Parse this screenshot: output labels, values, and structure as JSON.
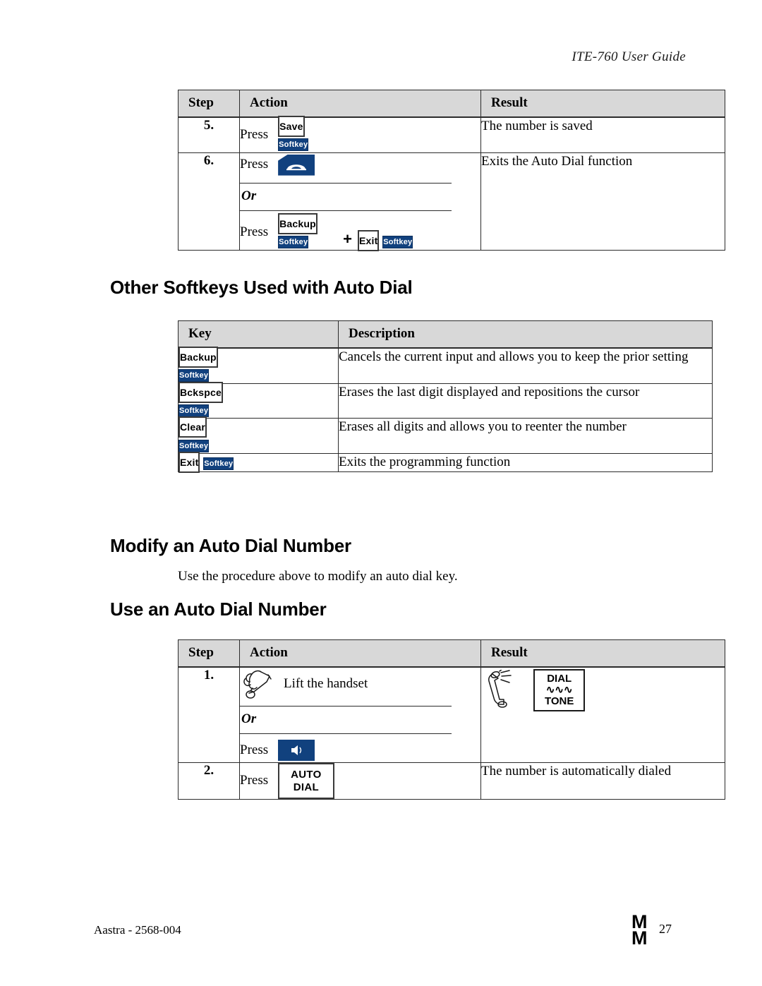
{
  "header": {
    "running_head": "ITE-760 User Guide"
  },
  "table_autodial_steps": {
    "columns": [
      "Step",
      "Action",
      "Result"
    ],
    "rows": [
      {
        "step": "5.",
        "press_label": "Press",
        "key": {
          "type": "softkey",
          "cap": "Save",
          "tag": "Softkey"
        },
        "result": "The number is saved"
      },
      {
        "step": "6.",
        "press_label": "Press",
        "key": {
          "type": "phone-key",
          "icon": "handset-icon"
        },
        "or_label": "Or",
        "press_label_2": "Press",
        "key_pair": {
          "first": {
            "cap": "Backup",
            "tag": "Softkey"
          },
          "operator": "+",
          "second": {
            "cap": "Exit",
            "tag": "Softkey"
          }
        },
        "result": "Exits the Auto Dial function"
      }
    ]
  },
  "heading_other_softkeys": "Other Softkeys Used with Auto Dial",
  "table_other_softkeys": {
    "columns": [
      "Key",
      "Description"
    ],
    "rows": [
      {
        "key_cap": "Backup",
        "key_tag": "Softkey",
        "description": "Cancels the current input and allows you to keep the prior setting"
      },
      {
        "key_cap": "Bckspce",
        "key_tag": "Softkey",
        "description": "Erases the last digit displayed and repositions the cursor"
      },
      {
        "key_cap": "Clear",
        "key_tag": "Softkey",
        "description": "Erases all digits and allows you to reenter the number"
      },
      {
        "key_cap": "Exit",
        "key_tag": "Softkey",
        "description": "Exits the programming function"
      }
    ]
  },
  "heading_modify": "Modify an Auto Dial Number",
  "paragraph_modify": "Use the procedure above to modify an auto dial key.",
  "heading_use": "Use an Auto Dial Number",
  "table_use_autodial": {
    "columns": [
      "Step",
      "Action",
      "Result"
    ],
    "rows": [
      {
        "step": "1.",
        "action_text": "Lift the handset",
        "action_icon": "lift-handset-icon",
        "or_label": "Or",
        "press_label": "Press",
        "key": {
          "type": "phone-key",
          "icon": "speaker-icon"
        },
        "result_icon": "ringing-handset-icon",
        "result_box": {
          "top": "DIAL",
          "wave": "∿∿∿",
          "bottom": "TONE"
        }
      },
      {
        "step": "2.",
        "press_label": "Press",
        "key": {
          "type": "framed-key",
          "line1": "AUTO",
          "line2": "DIAL"
        },
        "result": "The number is automatically dialed"
      }
    ]
  },
  "footer": {
    "left": "Aastra - 2568-004",
    "logo_line1": "M",
    "logo_line2": "M",
    "page_number": "27"
  },
  "colors": {
    "softkey_blue": "#11417e",
    "table_header_gray": "#d8d8d8",
    "border": "#2b2b2b"
  }
}
